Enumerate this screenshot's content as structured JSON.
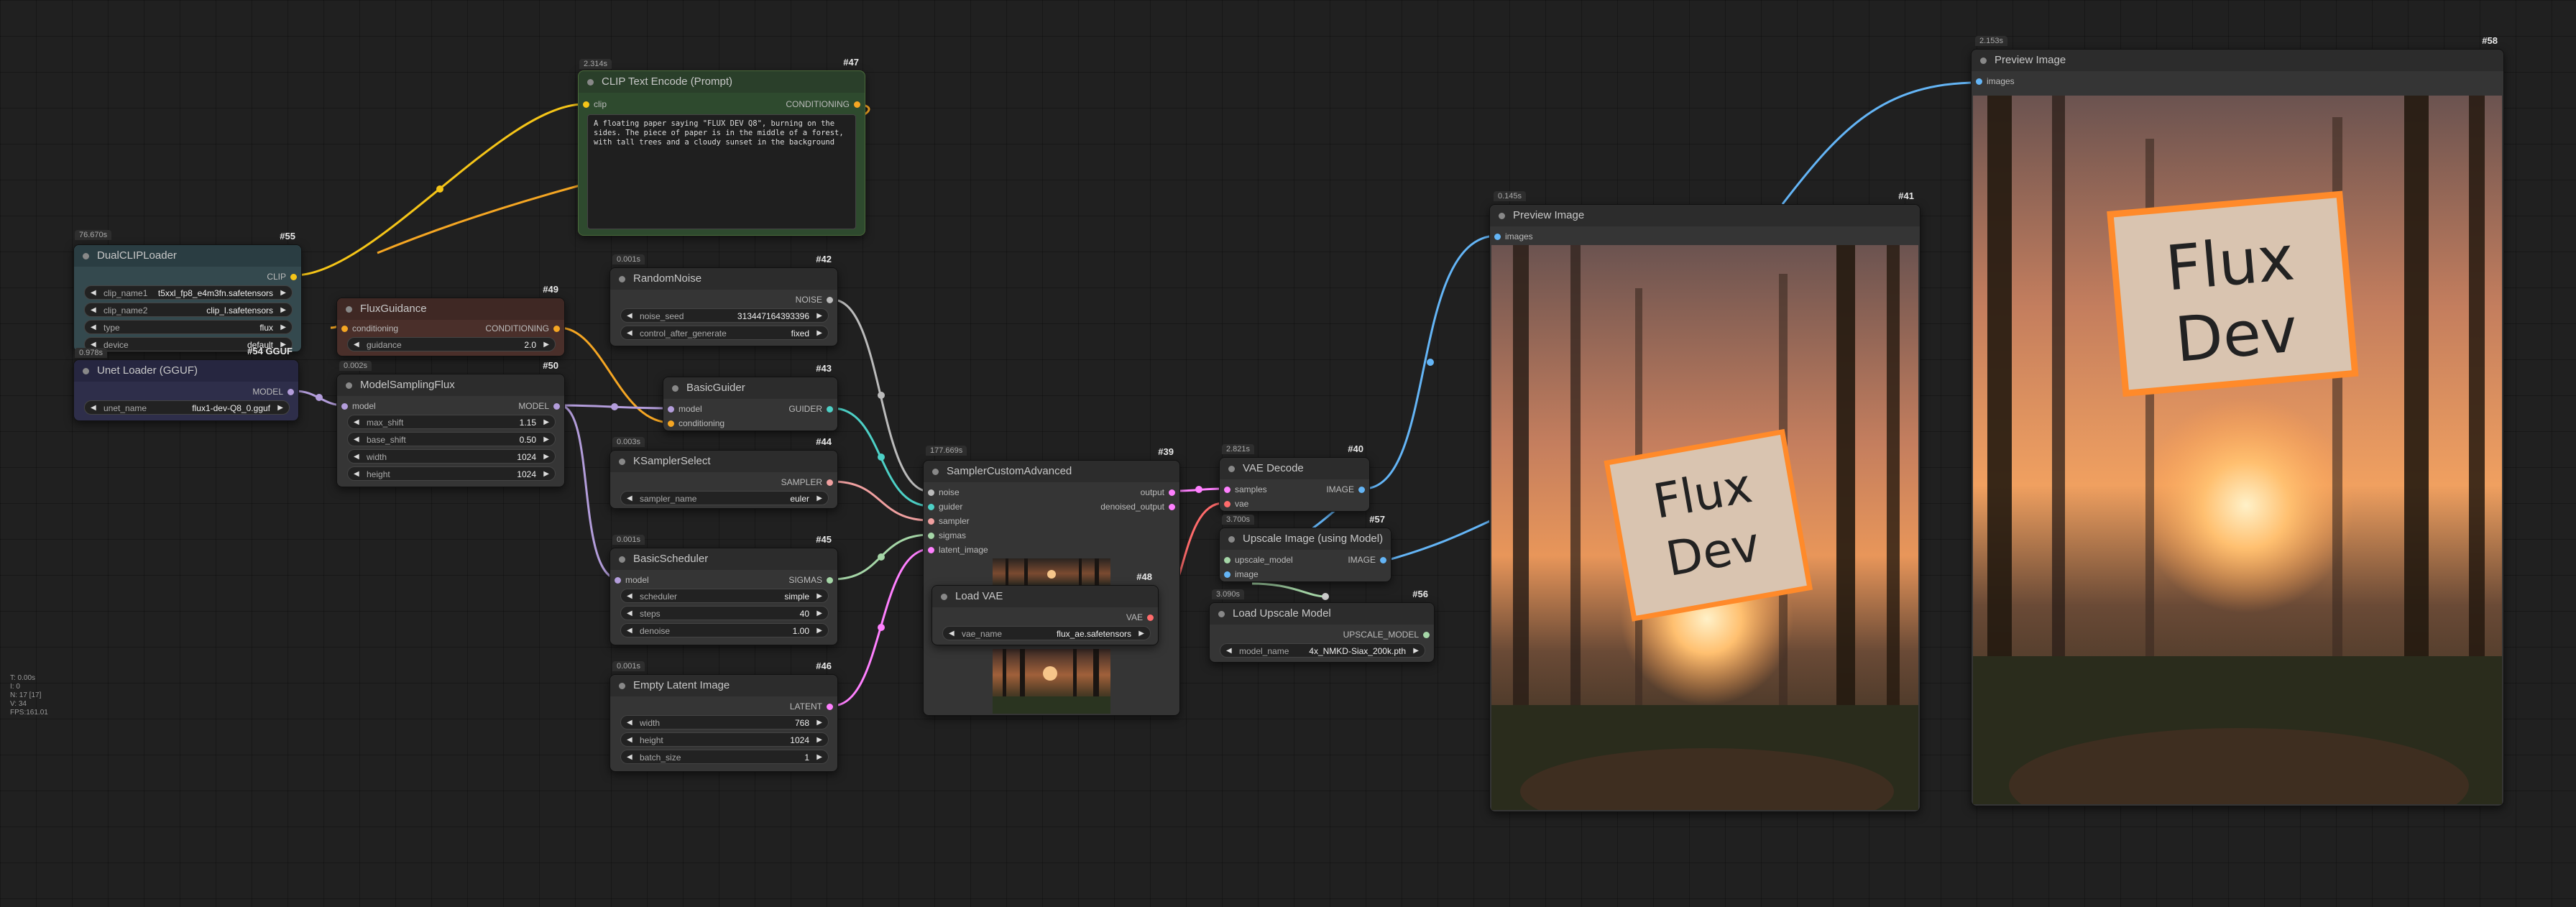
{
  "stats": {
    "line1": "T: 0.00s",
    "line2": "I: 0",
    "line3": "N: 17 [17]",
    "line4": "V: 34",
    "line5": "FPS:161.01"
  },
  "nodes": {
    "dualclip": {
      "time": "76.670s",
      "title": "DualCLIPLoader",
      "id": "#55",
      "out": "CLIP",
      "widgets": [
        {
          "label": "clip_name1",
          "value": "t5xxl_fp8_e4m3fn.safetensors"
        },
        {
          "label": "clip_name2",
          "value": "clip_l.safetensors"
        },
        {
          "label": "type",
          "value": "flux"
        },
        {
          "label": "device",
          "value": "default"
        }
      ]
    },
    "unet": {
      "time": "0.978s",
      "title": "Unet Loader (GGUF)",
      "id": "#54 GGUF",
      "out": "MODEL",
      "widgets": [
        {
          "label": "unet_name",
          "value": "flux1-dev-Q8_0.gguf"
        }
      ]
    },
    "clip_text": {
      "time": "2.314s",
      "title": "CLIP Text Encode (Prompt)",
      "id": "#47",
      "in": "clip",
      "out": "CONDITIONING",
      "text": "A floating paper saying \"FLUX DEV Q8\", burning on the sides. The piece of paper is in the middle of a forest, with tall trees and a cloudy sunset in the background"
    },
    "flux_guidance": {
      "title": "FluxGuidance",
      "id": "#49",
      "in": "conditioning",
      "out": "CONDITIONING",
      "widgets": [
        {
          "label": "guidance",
          "value": "2.0"
        }
      ]
    },
    "model_sampling": {
      "time": "0.002s",
      "title": "ModelSamplingFlux",
      "id": "#50",
      "in": "model",
      "out": "MODEL",
      "widgets": [
        {
          "label": "max_shift",
          "value": "1.15"
        },
        {
          "label": "base_shift",
          "value": "0.50"
        },
        {
          "label": "width",
          "value": "1024"
        },
        {
          "label": "height",
          "value": "1024"
        }
      ]
    },
    "random_noise": {
      "time": "0.001s",
      "title": "RandomNoise",
      "id": "#42",
      "out": "NOISE",
      "widgets": [
        {
          "label": "noise_seed",
          "value": "313447164393396"
        },
        {
          "label": "control_after_generate",
          "value": "fixed"
        }
      ]
    },
    "basic_guider": {
      "title": "BasicGuider",
      "id": "#43",
      "in1": "model",
      "in2": "conditioning",
      "out": "GUIDER"
    },
    "ksampler_select": {
      "time": "0.003s",
      "title": "KSamplerSelect",
      "id": "#44",
      "out": "SAMPLER",
      "widgets": [
        {
          "label": "sampler_name",
          "value": "euler"
        }
      ]
    },
    "basic_scheduler": {
      "time": "0.001s",
      "title": "BasicScheduler",
      "id": "#45",
      "in": "model",
      "out": "SIGMAS",
      "widgets": [
        {
          "label": "scheduler",
          "value": "simple"
        },
        {
          "label": "steps",
          "value": "40"
        },
        {
          "label": "denoise",
          "value": "1.00"
        }
      ]
    },
    "empty_latent": {
      "time": "0.001s",
      "title": "Empty Latent Image",
      "id": "#46",
      "out": "LATENT",
      "widgets": [
        {
          "label": "width",
          "value": "768"
        },
        {
          "label": "height",
          "value": "1024"
        },
        {
          "label": "batch_size",
          "value": "1"
        }
      ]
    },
    "sampler_custom": {
      "time": "177.669s",
      "title": "SamplerCustomAdvanced",
      "id": "#39",
      "inputs": [
        "noise",
        "guider",
        "sampler",
        "sigmas",
        "latent_image"
      ],
      "outputs": [
        "output",
        "denoised_output"
      ]
    },
    "load_vae": {
      "title": "Load VAE",
      "id": "#48",
      "out": "VAE",
      "widgets": [
        {
          "label": "vae_name",
          "value": "flux_ae.safetensors"
        }
      ]
    },
    "vae_decode": {
      "time": "2.821s",
      "title": "VAE Decode",
      "id": "#40",
      "in1": "samples",
      "in2": "vae",
      "out": "IMAGE"
    },
    "upscale_model": {
      "time": "3.700s",
      "title": "Upscale Image (using Model)",
      "id": "#57",
      "in1": "upscale_model",
      "in2": "image",
      "out": "IMAGE"
    },
    "load_upscale": {
      "time": "3.090s",
      "title": "Load Upscale Model",
      "id": "#56",
      "out": "UPSCALE_MODEL",
      "widgets": [
        {
          "label": "model_name",
          "value": "4x_NMKD-Siax_200k.pth"
        }
      ]
    },
    "preview1": {
      "time": "0.145s",
      "title": "Preview Image",
      "id": "#41",
      "in": "images",
      "image_text": "Flux\nDev"
    },
    "preview2": {
      "time": "2.153s",
      "title": "Preview Image",
      "id": "#58",
      "in": "images",
      "image_text": "Flux\nDev"
    }
  },
  "colors": {
    "clip": "#f5c518",
    "conditioning": "#f5a623",
    "model": "#b39ddb",
    "noise": "#bbbbbb",
    "guider": "#4dd0c6",
    "sampler": "#f0a0a0",
    "sigmas": "#a5d6a7",
    "latent": "#ff80ff",
    "vae": "#ff6b6b",
    "image": "#64b5f6",
    "upscale": "#a5d6a7"
  }
}
